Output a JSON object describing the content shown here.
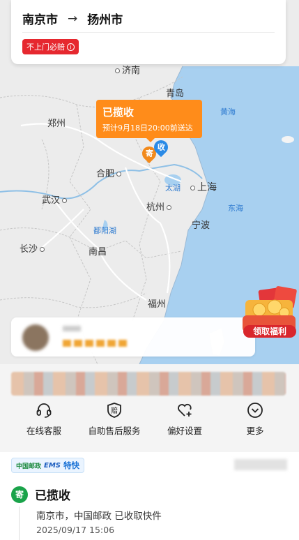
{
  "route": {
    "from": "南京市",
    "arrow": "→",
    "to": "扬州市",
    "badge": "不上门必赔",
    "badge_info": "i"
  },
  "map": {
    "cities": [
      "济南",
      "青岛",
      "郑州",
      "合肥",
      "武汉",
      "杭州",
      "上海",
      "宁波",
      "长沙",
      "南昌",
      "福州"
    ],
    "seas": [
      "黄海",
      "东海",
      "太湖",
      "鄱阳湖"
    ],
    "pin_send": "寄",
    "pin_receive": "收"
  },
  "tooltip": {
    "status": "已揽收",
    "eta": "预计9月18日20:00前送达"
  },
  "gift_label": "领取福利",
  "actions": [
    {
      "label": "在线客服",
      "icon": "headset-icon"
    },
    {
      "label": "自助售后服务",
      "icon": "compensation-icon"
    },
    {
      "label": "偏好设置",
      "icon": "heart-plus-icon"
    },
    {
      "label": "更多",
      "icon": "chevron-down-circle-icon"
    }
  ],
  "carrier": {
    "china_post": "中国邮政",
    "ems": "EMS",
    "type": "特快"
  },
  "timeline": {
    "icon": "寄",
    "status": "已揽收",
    "desc": "南京市，中国邮政 已收取快件",
    "time": "2025/09/17 15:06"
  },
  "colors": {
    "orange": "#ff8c1a",
    "red": "#e6282f",
    "green": "#1aa34a",
    "sea": "#a8d0f0"
  }
}
